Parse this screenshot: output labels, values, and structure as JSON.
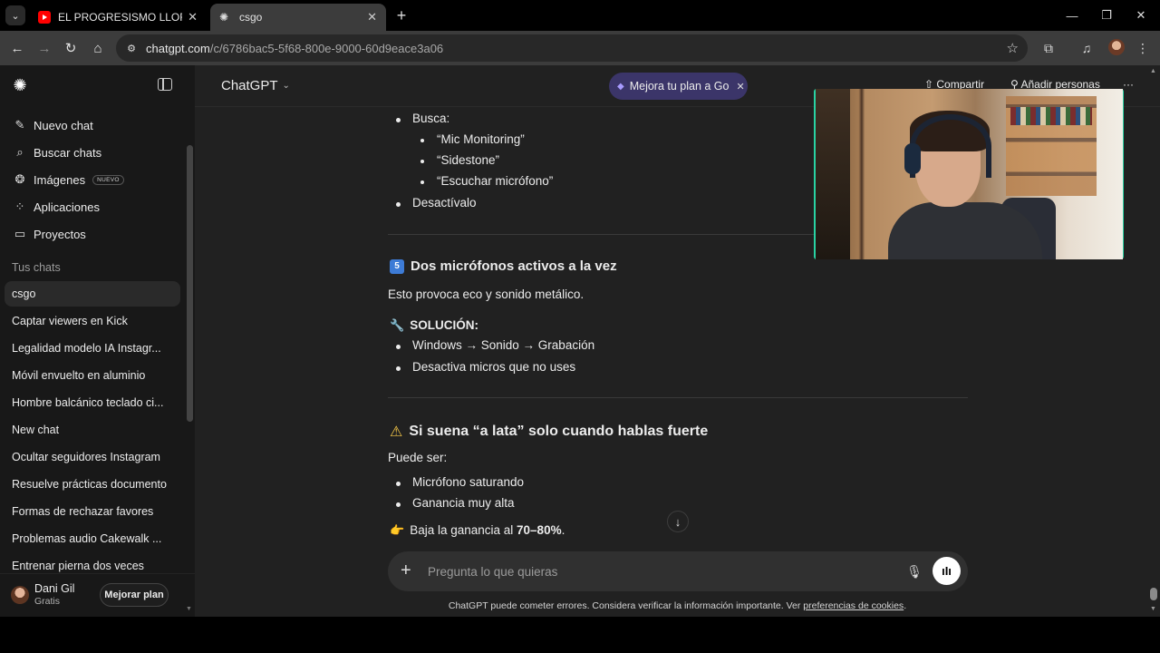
{
  "browser": {
    "tabs": [
      {
        "title": "EL PROGRESISMO LLORA CONT",
        "favicon": "youtube-icon",
        "active": false
      },
      {
        "title": "csgo",
        "favicon": "chatgpt-icon",
        "active": true
      }
    ],
    "url_host": "chatgpt.com",
    "url_path": "/c/6786bac5-5f68-800e-9000-60d9eace3a06"
  },
  "sidebar": {
    "nav": [
      {
        "label": "Nuevo chat",
        "icon": "edit-icon"
      },
      {
        "label": "Buscar chats",
        "icon": "search-icon"
      },
      {
        "label": "Imágenes",
        "icon": "images-icon",
        "badge": "NUEVO"
      },
      {
        "label": "Aplicaciones",
        "icon": "apps-icon"
      },
      {
        "label": "Proyectos",
        "icon": "folder-icon"
      }
    ],
    "section_title": "Tus chats",
    "chats": [
      "csgo",
      "Captar viewers en Kick",
      "Legalidad modelo IA Instagr...",
      "Móvil envuelto en aluminio",
      "Hombre balcánico teclado ci...",
      "New chat",
      "Ocultar seguidores Instagram",
      "Resuelve prácticas documento",
      "Formas de rechazar favores",
      "Problemas audio Cakewalk ...",
      "Entrenar pierna dos veces"
    ],
    "active_chat": "csgo",
    "user": {
      "name": "Dani Gil",
      "plan": "Gratis",
      "upgrade_label": "Mejorar plan"
    }
  },
  "header": {
    "model": "ChatGPT",
    "promo": "Mejora tu plan a Go",
    "share": "Compartir",
    "add_people": "Añadir personas"
  },
  "message": {
    "list_a": [
      {
        "text": "Busca:",
        "level": 1
      },
      {
        "text": "“Mic Monitoring”",
        "level": 2
      },
      {
        "text": "“Sidestone”",
        "level": 2
      },
      {
        "text": "“Escuchar micrófono”",
        "level": 2
      },
      {
        "text": "Desactívalo",
        "level": 1
      }
    ],
    "section5_number": "5",
    "section5_title": "Dos micrófonos activos a la vez",
    "section5_text": "Esto provoca eco y sonido metálico.",
    "solution_label": "SOLUCIÓN:",
    "list_b": [
      "Windows → Sonido → Grabación",
      "Desactiva micros que no uses"
    ],
    "section6_title": "Si suena “a lata” solo cuando hablas fuerte",
    "section6_text": "Puede ser:",
    "list_c": [
      "Micrófono saturando",
      "Ganancia muy alta"
    ],
    "tip_prefix": "Baja la ganancia al ",
    "tip_value": "70–80%",
    "tip_suffix": "."
  },
  "composer": {
    "placeholder": "Pregunta lo que quieras"
  },
  "disclaimer": {
    "text": "ChatGPT puede cometer errores. Considera verificar la información importante. Ver ",
    "link": "preferencias de cookies",
    "end": "."
  },
  "colors": {
    "accent_promo": "#3b3569",
    "webcam_border": "#29d3a3"
  }
}
